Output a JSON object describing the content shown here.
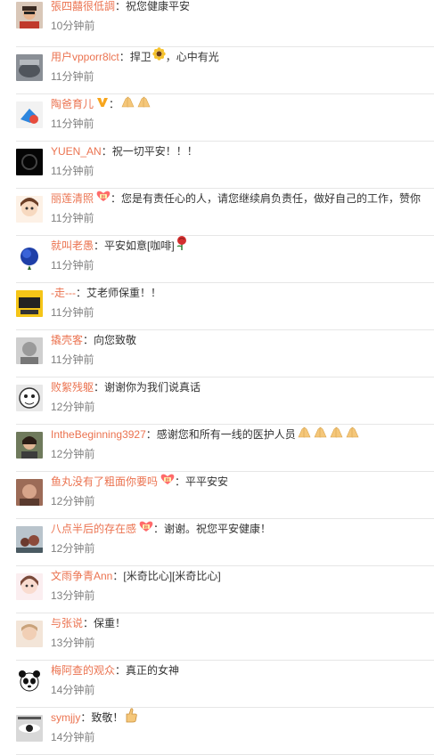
{
  "comments": [
    {
      "username": "張四囍很低調",
      "text": "祝您健康平安",
      "time": "10分钟前",
      "avatar": "av1",
      "badge": "",
      "emojis": []
    },
    {
      "username": "用户vpporr8lct",
      "text": "捍卫",
      "text2": "，心中有光",
      "time": "11分钟前",
      "avatar": "av2",
      "badge": "",
      "emojis": [
        "sunflower"
      ]
    },
    {
      "username": "陶爸育儿",
      "text": "",
      "time": "11分钟前",
      "avatar": "av3",
      "badge": "vip",
      "emojis": [
        "pray",
        "pray"
      ]
    },
    {
      "username": "YUEN_AN",
      "text": "祝一切平安！！！",
      "time": "11分钟前",
      "avatar": "av4",
      "badge": "",
      "emojis": []
    },
    {
      "username": "丽莲清照",
      "text": "您是有责任心的人，请您继续肩负责任，做好自己的工作，赞你",
      "time": "11分钟前",
      "avatar": "av5",
      "badge": "fan",
      "emojis": []
    },
    {
      "username": "就叫老愚",
      "text": "平安如意[咖啡]",
      "time": "11分钟前",
      "avatar": "av6",
      "badge": "",
      "emojis": [
        "rose"
      ]
    },
    {
      "username": "-走---",
      "text": "艾老师保重！！",
      "time": "11分钟前",
      "avatar": "av7",
      "badge": "",
      "emojis": []
    },
    {
      "username": "撬壳客",
      "text": "向您致敬",
      "time": "11分钟前",
      "avatar": "av8",
      "badge": "",
      "emojis": []
    },
    {
      "username": "败絮残躯",
      "text": "谢谢你为我们说真话",
      "time": "12分钟前",
      "avatar": "av9",
      "badge": "",
      "emojis": []
    },
    {
      "username": "IntheBeginning3927",
      "text": "感谢您和所有一线的医护人员",
      "time": "12分钟前",
      "avatar": "av10",
      "badge": "",
      "emojis": [
        "pray",
        "pray",
        "pray",
        "pray"
      ]
    },
    {
      "username": "鱼丸没有了粗面你要吗",
      "text": "平平安安",
      "time": "12分钟前",
      "avatar": "av11",
      "badge": "fan",
      "emojis": []
    },
    {
      "username": "八点半后的存在感",
      "text": "谢谢。祝您平安健康！",
      "time": "12分钟前",
      "avatar": "av12",
      "badge": "fan",
      "emojis": []
    },
    {
      "username": "文雨争青Ann",
      "text": "[米奇比心][米奇比心]",
      "time": "13分钟前",
      "avatar": "av13",
      "badge": "",
      "emojis": []
    },
    {
      "username": "与张说",
      "text": "保重！",
      "time": "13分钟前",
      "avatar": "av14",
      "badge": "",
      "emojis": []
    },
    {
      "username": "梅阿查的观众",
      "text": "真正的女神",
      "time": "14分钟前",
      "avatar": "av15",
      "badge": "",
      "emojis": []
    },
    {
      "username": "symjjy",
      "text": "致敬！",
      "time": "14分钟前",
      "avatar": "av16",
      "badge": "",
      "emojis": [
        "thumb"
      ]
    }
  ],
  "colors": {
    "username": "#eb7350",
    "text": "#333333",
    "time": "#808080",
    "separator": "#e6e6e6"
  }
}
